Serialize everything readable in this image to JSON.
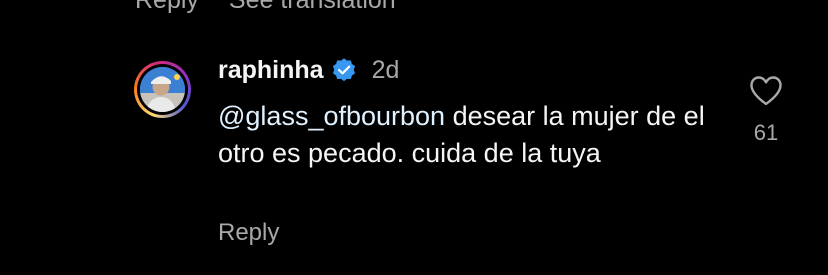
{
  "previous_comment": {
    "reply_label": "Reply",
    "translation_label": "See translation"
  },
  "comment": {
    "username": "raphinha",
    "verified": true,
    "time": "2d",
    "mention": "@glass_ofbourbon",
    "text": " desear la mujer de el otro es pecado.  cuida de la tuya",
    "reply_label": "Reply",
    "like_count": "61"
  },
  "colors": {
    "background": "#000000",
    "primary_text": "#f5f5f5",
    "secondary_text": "#a8a8a8",
    "mention": "#e0f1ff",
    "verified_badge": "#3897f0"
  },
  "icons": {
    "verified": "verified-badge-icon",
    "like": "heart-outline-icon"
  }
}
